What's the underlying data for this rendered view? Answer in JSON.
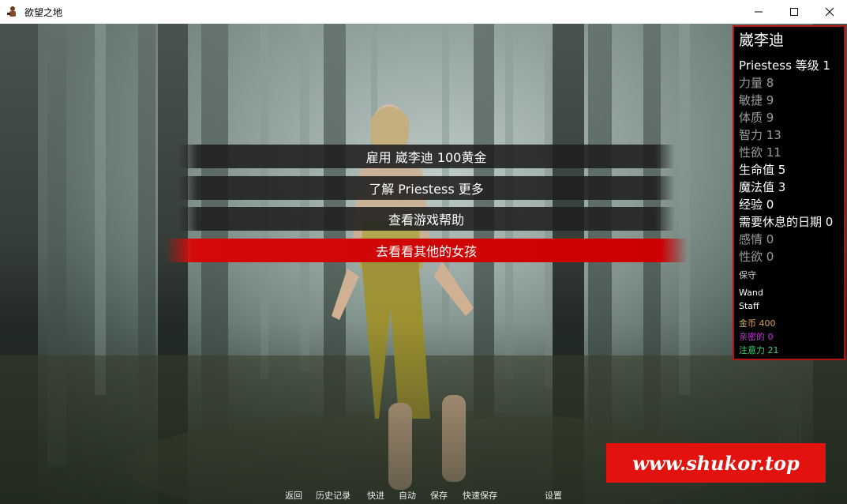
{
  "window": {
    "title": "欲望之地",
    "controls": [
      "minimize-icon",
      "maximize-icon",
      "close-icon"
    ]
  },
  "menu": [
    {
      "label": "雇用 崴李迪 100黄金",
      "selected": false
    },
    {
      "label": "了解 Priestess 更多",
      "selected": false
    },
    {
      "label": "查看游戏帮助",
      "selected": false
    },
    {
      "label": "去看看其他的女孩",
      "selected": true
    }
  ],
  "character": {
    "name": "崴李迪",
    "class_level": "Priestess 等级 1",
    "stats": [
      {
        "text": "力量 8",
        "style": "grey"
      },
      {
        "text": "敏捷 9",
        "style": "grey"
      },
      {
        "text": "体质 9",
        "style": "grey"
      },
      {
        "text": "智力 13",
        "style": "grey"
      },
      {
        "text": "性欲 11",
        "style": "grey"
      },
      {
        "text": "生命值 5",
        "style": "white"
      },
      {
        "text": "魔法值 3",
        "style": "white"
      },
      {
        "text": "经验 0",
        "style": "white"
      },
      {
        "text": "需要休息的日期 0",
        "style": "white"
      },
      {
        "text": "感情 0",
        "style": "grey"
      },
      {
        "text": "性欲 0",
        "style": "grey"
      }
    ],
    "trait": "保守",
    "equipment": [
      "Wand",
      "Staff"
    ],
    "gold": "金币 400",
    "intimacy": "亲密的 0",
    "attention": "注意力 21"
  },
  "colors": {
    "gold": "#d4a64a",
    "intimacy": "#c434d8",
    "attention": "#3cd070",
    "panel_border": "#b31212",
    "selected_menu": "#cc0000"
  },
  "quick_menu": [
    {
      "label": "返回"
    },
    {
      "label": "历史记录"
    },
    {
      "label": "快进"
    },
    {
      "label": "自动"
    },
    {
      "label": "保存"
    },
    {
      "label": "快速保存"
    },
    {
      "label": "设置"
    }
  ],
  "watermark": "www.shukor.top"
}
